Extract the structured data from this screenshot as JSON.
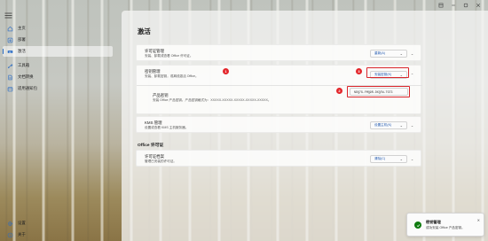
{
  "sidebar": {
    "items": [
      {
        "label": "主页",
        "icon": "home-icon"
      },
      {
        "label": "部署",
        "icon": "download-icon"
      },
      {
        "label": "激活",
        "icon": "key-icon"
      },
      {
        "label": "工具箱",
        "icon": "toolbox-icon"
      },
      {
        "label": "文档转换",
        "icon": "document-convert-icon"
      },
      {
        "label": "适用通知包",
        "icon": "package-icon"
      }
    ],
    "bottom": [
      {
        "label": "设置",
        "icon": "gear-icon"
      },
      {
        "label": "关于",
        "icon": "info-icon"
      }
    ]
  },
  "page": {
    "title": "激活"
  },
  "cards": {
    "license_mgmt": {
      "title": "许可证管理",
      "desc": "安装、卸载或查看 Office 许可证。",
      "button": "重新(A)"
    },
    "key_mgmt": {
      "title": "密钥管理",
      "desc": "安装、卸载密钥，或离线激活 Office。",
      "button": "安装密钥(K)"
    },
    "product_key": {
      "title": "产品密钥",
      "desc": "安装 Office 产品密钥。产品密钥格式为：XXXXX-XXXXX-XXXXX-XXXXX-XXXXX。",
      "value": "NDQ7G-FMQ9R-DXQ7W-TGT3"
    },
    "kms_mgmt": {
      "title": "KMS 管理",
      "desc": "设置或查看 KMS 主机服务器。",
      "button": "设置主机(K)"
    },
    "license_files": {
      "title": "许可证档案",
      "desc": "管理已安装的许可证。",
      "button": "清除(C)"
    }
  },
  "section": {
    "office_license": "Office 许可证"
  },
  "annotations": {
    "badge1": "1",
    "badge2": "2",
    "badge3": "3"
  },
  "toast": {
    "title": "密钥管理",
    "message": "成功安装 Office 产品密钥。",
    "close": "✕"
  },
  "colors": {
    "accent": "#2b6cc4",
    "annotation": "#d9252b",
    "success": "#0f7b0f"
  }
}
